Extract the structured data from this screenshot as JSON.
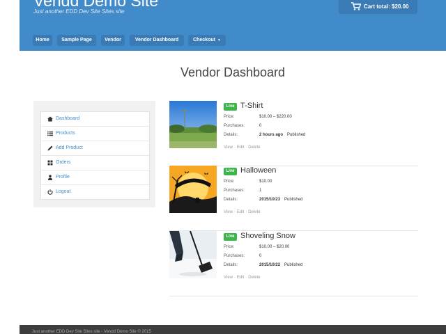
{
  "header": {
    "site_title": "Vendd Demo Site",
    "tagline": "Just another EDD Dev Site Sites site",
    "cart_label": "Cart total: $20.00",
    "cart_icon": "shopping-cart-icon"
  },
  "nav": {
    "items": [
      {
        "label": "Home"
      },
      {
        "label": "Sample Page"
      },
      {
        "label": "Vendor"
      },
      {
        "label": "Vendor Dashboard"
      },
      {
        "label": "Checkout"
      }
    ]
  },
  "main": {
    "title": "Vendor Dashboard"
  },
  "sidebar": {
    "items": [
      {
        "label": "Dashboard",
        "icon": "home-icon"
      },
      {
        "label": "Products",
        "icon": "list-icon"
      },
      {
        "label": "Add Product",
        "icon": "pencil-icon"
      },
      {
        "label": "Orders",
        "icon": "grid-icon"
      },
      {
        "label": "Profile",
        "icon": "user-icon"
      },
      {
        "label": "Logout",
        "icon": "power-icon"
      }
    ]
  },
  "products": {
    "labels": {
      "price": "Price:",
      "purchases": "Purchases:",
      "details": "Details:"
    },
    "actions": {
      "view": "View",
      "edit": "Edit",
      "delete": "Delete",
      "sep": "·"
    },
    "items": [
      {
        "status": "Live",
        "title": "T-Shirt",
        "price": "$10.00 – $220.00",
        "purchases": "0",
        "date": "2 hours ago",
        "published": "Published"
      },
      {
        "status": "Live",
        "title": "Halloween",
        "price": "$10.00",
        "purchases": "1",
        "date": "2015/10/23",
        "published": "Published"
      },
      {
        "status": "Live",
        "title": "Shoveling Snow",
        "price": "$10.00 – $20.00",
        "purchases": "0",
        "date": "2015/10/22",
        "published": "Published"
      }
    ]
  },
  "footer": {
    "text": "Just another EDD Dev Site Sites site - Vendd Demo Site © 2015"
  },
  "colors": {
    "header_blue": "#428bca",
    "nav_button": "#3a7bb5",
    "live_badge": "#3cb54b",
    "footer": "#3d3d3d"
  }
}
